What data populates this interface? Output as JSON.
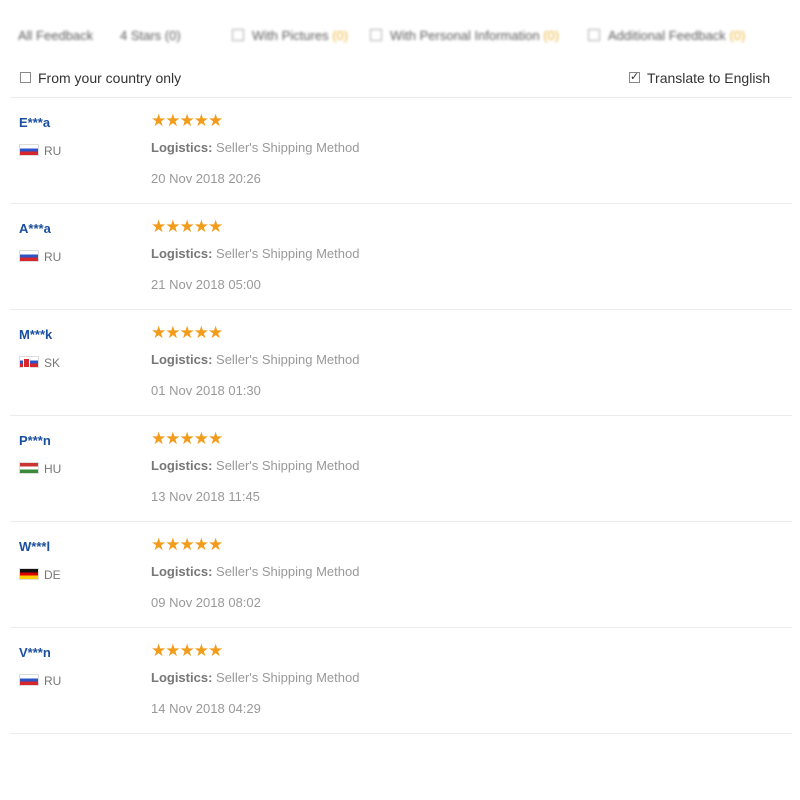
{
  "top_filters": [
    {
      "label": "All Feedback",
      "checkbox": false,
      "count": ""
    },
    {
      "label": "4 Stars (0)",
      "checkbox": false,
      "count": ""
    },
    {
      "label": "With Pictures",
      "checkbox": true,
      "count": "(0)"
    },
    {
      "label": "With Personal Information",
      "checkbox": true,
      "count": "(0)"
    },
    {
      "label": "Additional Feedback",
      "checkbox": true,
      "count": "(0)"
    }
  ],
  "options": {
    "country_only": {
      "label": "From your country only",
      "checked": false
    },
    "translate": {
      "label": "Translate to English",
      "checked": true
    }
  },
  "logistics_prefix": "Logistics:",
  "colors": {
    "accent_star": "#f29c1b",
    "user_link": "#1a4fa0"
  },
  "reviews": [
    {
      "user": "E***a",
      "country": "RU",
      "flag": "ru-flag-icon",
      "rating": 5,
      "logistics": "Seller's Shipping Method",
      "date": "20 Nov 2018 20:26"
    },
    {
      "user": "A***a",
      "country": "RU",
      "flag": "ru-flag-icon",
      "rating": 5,
      "logistics": "Seller's Shipping Method",
      "date": "21 Nov 2018 05:00"
    },
    {
      "user": "M***k",
      "country": "SK",
      "flag": "sk-flag-icon",
      "rating": 5,
      "logistics": "Seller's Shipping Method",
      "date": "01 Nov 2018 01:30"
    },
    {
      "user": "P***n",
      "country": "HU",
      "flag": "hu-flag-icon",
      "rating": 5,
      "logistics": "Seller's Shipping Method",
      "date": "13 Nov 2018 11:45"
    },
    {
      "user": "W***l",
      "country": "DE",
      "flag": "de-flag-icon",
      "rating": 5,
      "logistics": "Seller's Shipping Method",
      "date": "09 Nov 2018 08:02"
    },
    {
      "user": "V***n",
      "country": "RU",
      "flag": "ru-flag-icon",
      "rating": 5,
      "logistics": "Seller's Shipping Method",
      "date": "14 Nov 2018 04:29"
    }
  ]
}
